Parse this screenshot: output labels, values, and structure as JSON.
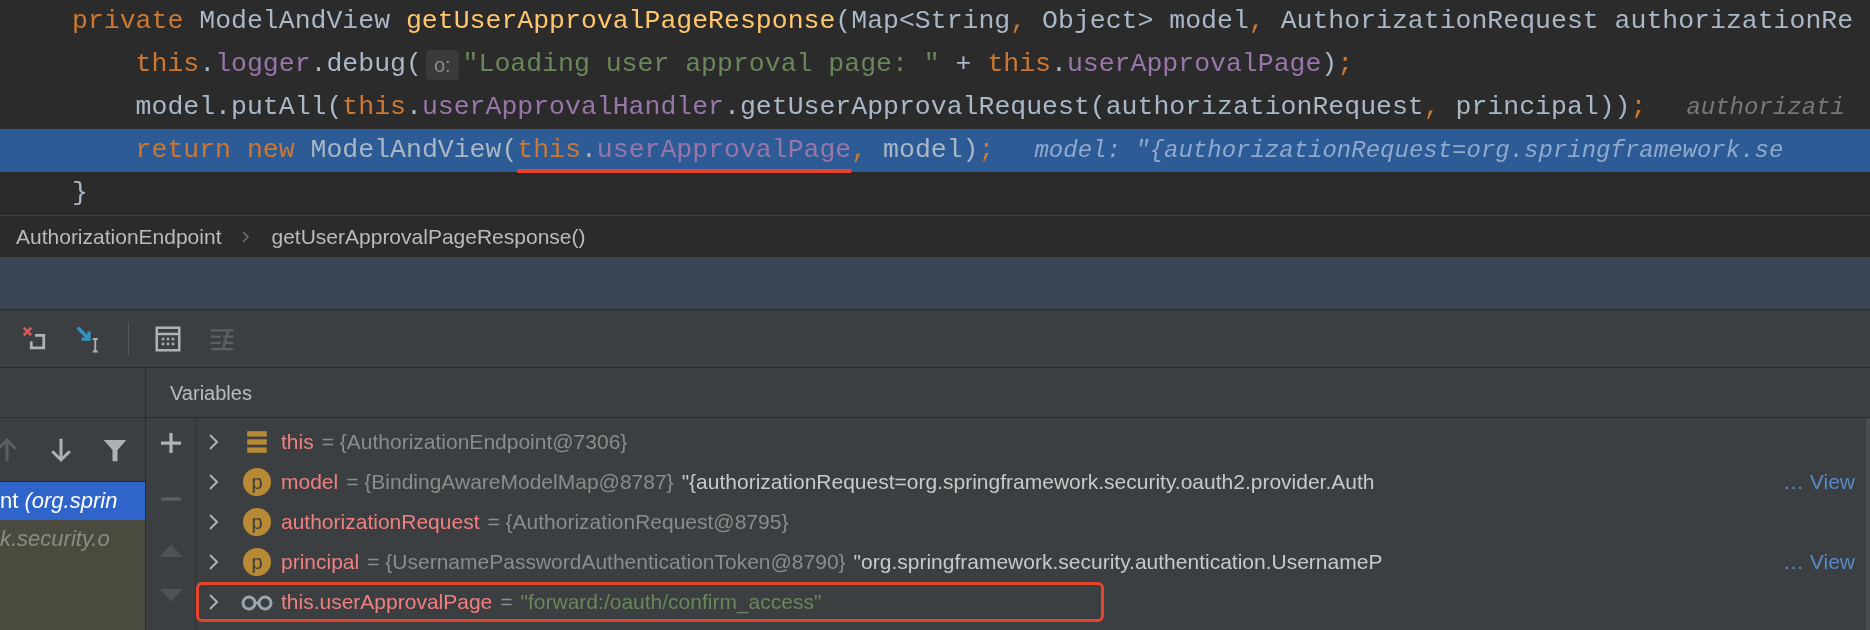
{
  "editor": {
    "lines": [
      {
        "current": false,
        "tokens": [
          {
            "text": "private",
            "kind": "keyword"
          },
          {
            "text": " ModelAndView ",
            "kind": "plain"
          },
          {
            "text": "getUserApprovalPageResponse",
            "kind": "method"
          },
          {
            "text": "(Map<String",
            "kind": "plain"
          },
          {
            "text": ",",
            "kind": "keyword"
          },
          {
            "text": " Object> model",
            "kind": "plain"
          },
          {
            "text": ",",
            "kind": "keyword"
          },
          {
            "text": " AuthorizationRequest authorizationRe",
            "kind": "plain"
          }
        ],
        "children": [
          {
            "current": false,
            "tokens": [
              {
                "text": "this",
                "kind": "keyword"
              },
              {
                "text": ".",
                "kind": "plain"
              },
              {
                "text": "logger",
                "kind": "field"
              },
              {
                "text": ".debug(",
                "kind": "plain"
              },
              {
                "text": "o:",
                "kind": "hint"
              },
              {
                "text": "\"Loading user approval page: \"",
                "kind": "string"
              },
              {
                "text": " + ",
                "kind": "plain"
              },
              {
                "text": "this",
                "kind": "keyword"
              },
              {
                "text": ".",
                "kind": "plain"
              },
              {
                "text": "userApprovalPage",
                "kind": "field"
              },
              {
                "text": ")",
                "kind": "plain"
              },
              {
                "text": ";",
                "kind": "keyword"
              }
            ]
          },
          {
            "current": false,
            "tokens": [
              {
                "text": "model.putAll(",
                "kind": "plain"
              },
              {
                "text": "this",
                "kind": "keyword"
              },
              {
                "text": ".",
                "kind": "plain"
              },
              {
                "text": "userApprovalHandler",
                "kind": "field"
              },
              {
                "text": ".getUserApprovalRequest(authorizationRequest",
                "kind": "plain"
              },
              {
                "text": ",",
                "kind": "keyword"
              },
              {
                "text": " principal))",
                "kind": "plain"
              },
              {
                "text": ";",
                "kind": "keyword"
              },
              {
                "text": "authorizati",
                "kind": "inline_value"
              }
            ]
          },
          {
            "current": true,
            "tokens": [
              {
                "text": "return",
                "kind": "keyword"
              },
              {
                "text": " new",
                "kind": "keyword"
              },
              {
                "text": " ModelAndView(",
                "kind": "plain"
              },
              {
                "text": "this",
                "kind": "keyword",
                "marked": true
              },
              {
                "text": ".",
                "kind": "plain",
                "marked": true
              },
              {
                "text": "userApprovalPage",
                "kind": "field",
                "marked": true
              },
              {
                "text": ",",
                "kind": "keyword"
              },
              {
                "text": " model)",
                "kind": "plain"
              },
              {
                "text": ";",
                "kind": "keyword"
              },
              {
                "text": "model: \"{authorizationRequest=org.springframework.se",
                "kind": "inline_value"
              }
            ]
          }
        ]
      },
      {
        "current": false,
        "tokens": [
          {
            "text": "}",
            "kind": "plain"
          }
        ]
      }
    ]
  },
  "breadcrumb": [
    "AuthorizationEndpoint",
    "getUserApprovalPageResponse()"
  ],
  "toolbar": [
    {
      "kind": "drop-frame",
      "disabled": false
    },
    {
      "kind": "run-to-cursor",
      "disabled": false
    },
    {
      "kind": "calculator",
      "disabled": false
    },
    {
      "kind": "trace",
      "disabled": true
    }
  ],
  "frames": {
    "toolbar": [
      {
        "kind": "up",
        "disabled": true
      },
      {
        "kind": "down",
        "disabled": false
      },
      {
        "kind": "filter",
        "disabled": false
      }
    ],
    "items": [
      {
        "text": "nt *(org.sprin*",
        "selected": true
      },
      {
        "text": "k.security.o",
        "selected": false
      }
    ]
  },
  "variables": {
    "title": "Variables",
    "gutter": [
      {
        "kind": "plus",
        "disabled": false
      },
      {
        "kind": "minus",
        "disabled": true
      },
      {
        "kind": "up",
        "disabled": true
      },
      {
        "kind": "down",
        "disabled": true
      }
    ],
    "rows": [
      {
        "kind": "field",
        "expanded": false,
        "boxed": false,
        "name": "this",
        "value": "= {AuthorizationEndpoint@7306}"
      },
      {
        "kind": "param",
        "badge": "p",
        "expanded": false,
        "boxed": false,
        "name": "model",
        "value": "= {BindingAwareModelMap@8787}",
        "text": "\"{authorizationRequest=org.springframework.security.oauth2.provider.Auth",
        "link": "… View"
      },
      {
        "kind": "param",
        "badge": "p",
        "expanded": false,
        "boxed": false,
        "name": "authorizationRequest",
        "value": "= {AuthorizationRequest@8795}"
      },
      {
        "kind": "param",
        "badge": "p",
        "expanded": false,
        "boxed": false,
        "name": "principal",
        "value": "= {UsernamePasswordAuthenticationToken@8790}",
        "text": "\"org.springframework.security.authentication.UsernameP",
        "link": "… View"
      },
      {
        "kind": "watch",
        "expanded": false,
        "boxed": true,
        "name": "this.userApprovalPage",
        "value": "=",
        "string": "\"forward:/oauth/confirm_access\""
      }
    ]
  }
}
